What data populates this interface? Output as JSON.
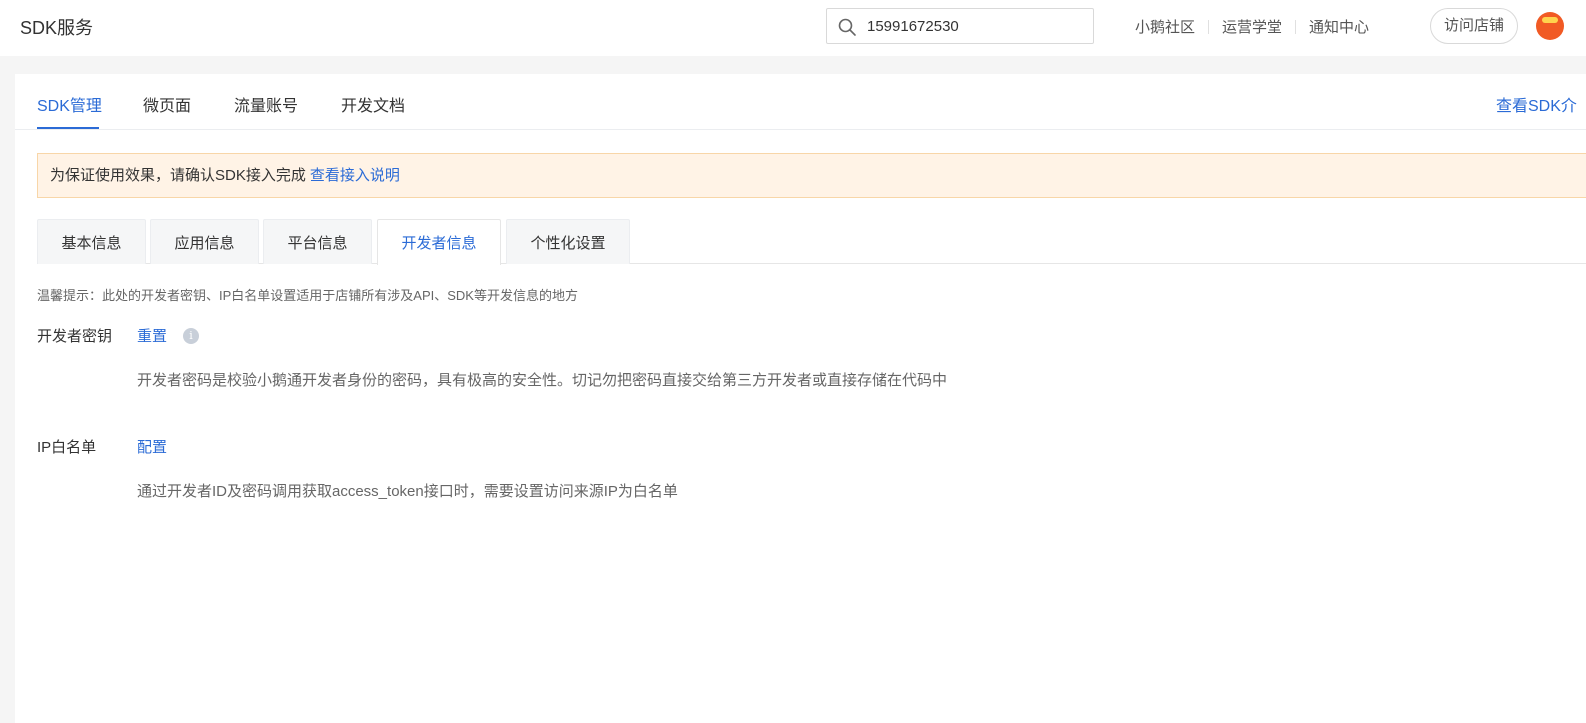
{
  "header": {
    "app_title": "SDK服务",
    "search_value": "15991672530",
    "links": [
      "小鹅社区",
      "运营学堂",
      "通知中心"
    ],
    "visit_store": "访问店铺"
  },
  "main_tabs": {
    "items": [
      "SDK管理",
      "微页面",
      "流量账号",
      "开发文档"
    ],
    "right_link": "查看SDK介"
  },
  "notice": {
    "text": "为保证使用效果，请确认SDK接入完成",
    "link": "查看接入说明"
  },
  "sub_tabs": [
    "基本信息",
    "应用信息",
    "平台信息",
    "开发者信息",
    "个性化设置"
  ],
  "hint": "温馨提示：此处的开发者密钥、IP白名单设置适用于店铺所有涉及API、SDK等开发信息的地方",
  "fields": [
    {
      "label": "开发者密钥",
      "action": "重置",
      "info": "i",
      "desc": "开发者密码是校验小鹅通开发者身份的密码，具有极高的安全性。切记勿把密码直接交给第三方开发者或直接存储在代码中"
    },
    {
      "label": "IP白名单",
      "action": "配置",
      "desc": "通过开发者ID及密码调用获取access_token接口时，需要设置访问来源IP为白名单"
    }
  ],
  "colors": {
    "accent": "#2b6bd6",
    "notice_bg": "#fff3e6"
  }
}
